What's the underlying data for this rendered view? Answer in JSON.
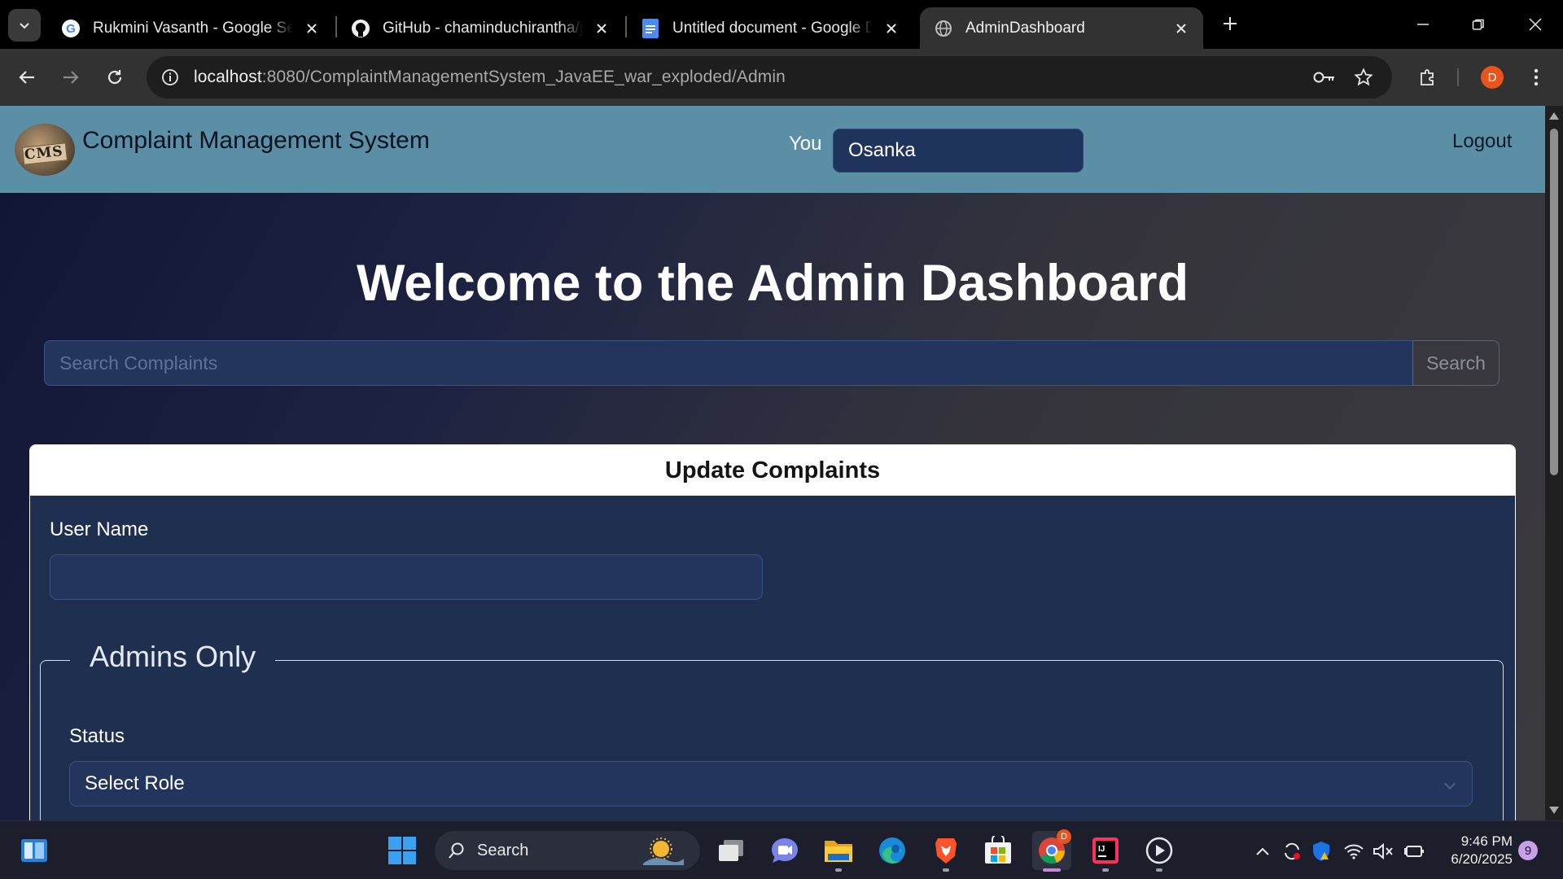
{
  "browser": {
    "tabs": [
      {
        "title": "Rukmini Vasanth - Google Search",
        "icon": "google-icon"
      },
      {
        "title": "GitHub - chaminduchirantha/java",
        "icon": "github-icon"
      },
      {
        "title": "Untitled document - Google Docs",
        "icon": "google-docs-icon"
      },
      {
        "title": "AdminDashboard",
        "icon": "globe-icon",
        "active": true
      }
    ],
    "url_host": "localhost",
    "url_rest": ":8080/ComplaintManagementSystem_JavaEE_war_exploded/Admin",
    "profile_initial": "D"
  },
  "navbar": {
    "logo_text": "CMS",
    "brand": "Complaint Management System",
    "you_label": "You",
    "user_name": "Osanka",
    "logout_label": "Logout"
  },
  "main": {
    "heading": "Welcome to the Admin Dashboard",
    "search_placeholder": "Search Complaints",
    "search_button": "Search"
  },
  "update_card": {
    "title": "Update Complaints",
    "user_name_label": "User Name",
    "user_name_value": "",
    "admins_legend": "Admins Only",
    "status_label": "Status",
    "status_selected": "Select Role"
  },
  "taskbar": {
    "search_label": "Search",
    "time": "9:46 PM",
    "date": "6/20/2025",
    "notification_count": "9",
    "chrome_badge": "D"
  },
  "colors": {
    "navbar": "#5b8fa6",
    "field_bg": "#24355d",
    "card_bg": "#1f2f50"
  }
}
